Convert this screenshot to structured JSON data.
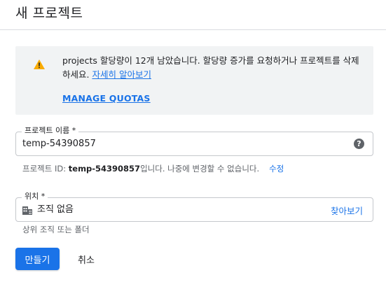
{
  "header": {
    "title": "새 프로젝트"
  },
  "notice": {
    "icon": "warning-icon",
    "text": "projects 할당량이 12개 남았습니다. 할당량 증가를 요청하거나 프로젝트를 삭제하세요.",
    "link_label": "자세히 알아보기",
    "manage_label": "MANAGE QUOTAS"
  },
  "project_name": {
    "label": "프로젝트 이름 *",
    "value": "temp-54390857",
    "help_icon": "help-icon"
  },
  "project_id": {
    "prefix": "프로젝트 ID: ",
    "id": "temp-54390857",
    "suffix": "입니다. 나중에 변경할 수 없습니다.",
    "edit_label": "수정"
  },
  "location": {
    "label": "위치 *",
    "icon": "organization-icon",
    "value": "조직 없음",
    "browse_label": "찾아보기",
    "helper": "상위 조직 또는 폴더"
  },
  "actions": {
    "create_label": "만들기",
    "cancel_label": "취소"
  },
  "colors": {
    "accent": "#1a73e8",
    "warning": "#f9ab00",
    "notice_bg": "#f1f3f4"
  }
}
